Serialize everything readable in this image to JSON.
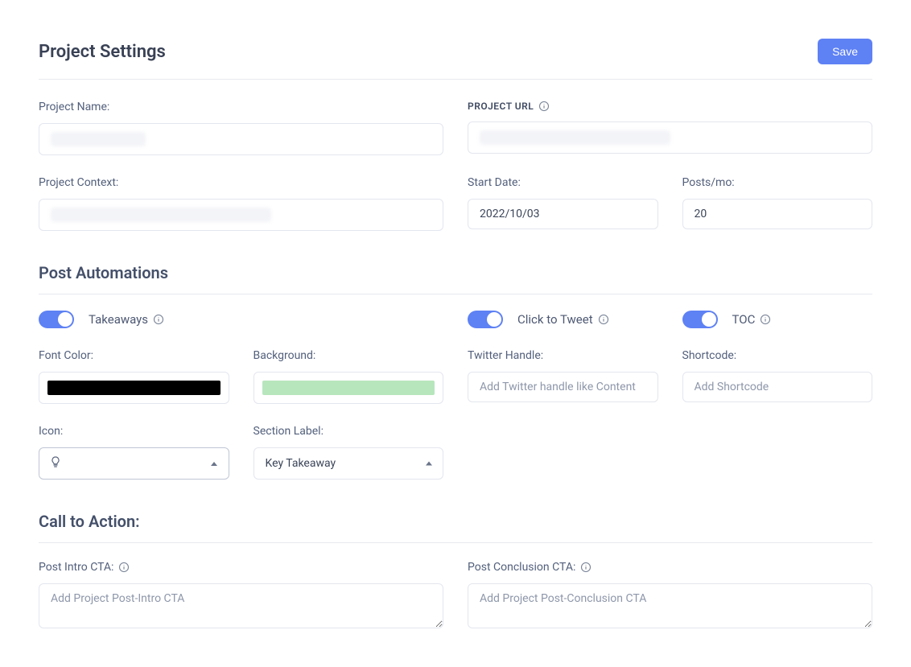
{
  "header": {
    "title": "Project Settings",
    "save_label": "Save"
  },
  "fields": {
    "project_name_label": "Project Name:",
    "project_name_value": "",
    "project_url_label": "PROJECT URL",
    "project_url_value": "",
    "project_context_label": "Project Context:",
    "project_context_value": "",
    "start_date_label": "Start Date:",
    "start_date_value": "2022/10/03",
    "posts_per_mo_label": "Posts/mo:",
    "posts_per_mo_value": "20"
  },
  "automations": {
    "section_title": "Post Automations",
    "takeaways_label": "Takeaways",
    "click_to_tweet_label": "Click to Tweet",
    "toc_label": "TOC",
    "font_color_label": "Font Color:",
    "font_color_value": "#000000",
    "background_label": "Background:",
    "background_value": "#b7e6bd",
    "twitter_handle_label": "Twitter Handle:",
    "twitter_handle_placeholder": "Add Twitter handle like Content",
    "shortcode_label": "Shortcode:",
    "shortcode_placeholder": "Add Shortcode",
    "icon_label": "Icon:",
    "icon_value": "lightbulb",
    "section_label_label": "Section Label:",
    "section_label_value": "Key Takeaway"
  },
  "cta": {
    "section_title": "Call to Action:",
    "post_intro_label": "Post Intro CTA:",
    "post_intro_placeholder": "Add Project Post-Intro CTA",
    "post_conclusion_label": "Post Conclusion CTA:",
    "post_conclusion_placeholder": "Add Project Post-Conclusion CTA"
  }
}
